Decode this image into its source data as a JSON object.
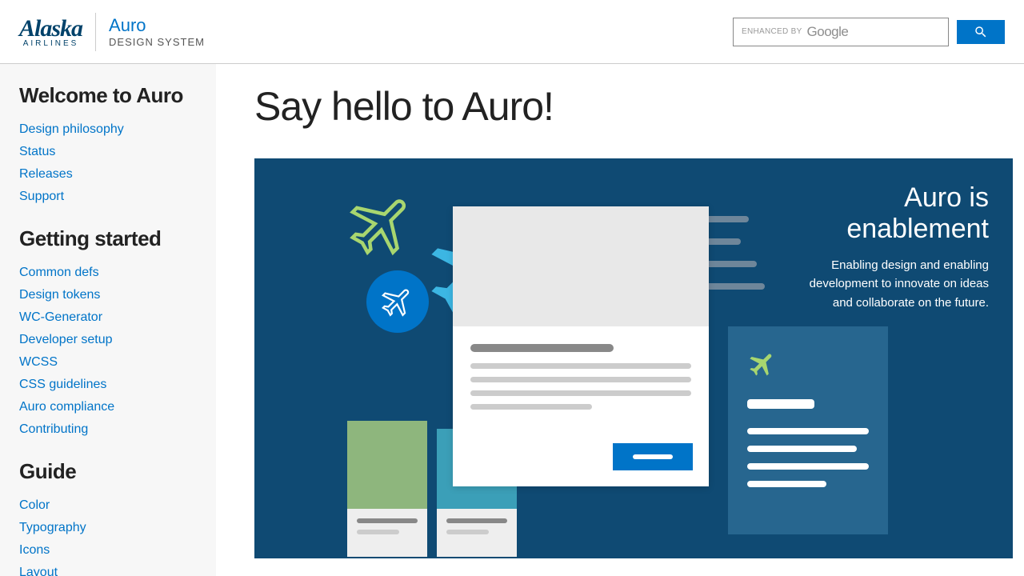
{
  "header": {
    "logo": {
      "brand": "Alaska",
      "brand_sub": "AIRLINES",
      "product": "Auro",
      "product_sub": "DESIGN SYSTEM"
    },
    "search": {
      "enhanced": "ENHANCED BY",
      "google": "Google"
    }
  },
  "sidebar": {
    "groups": [
      {
        "heading": "Welcome to Auro",
        "links": [
          "Design philosophy",
          "Status",
          "Releases",
          "Support"
        ]
      },
      {
        "heading": "Getting started",
        "links": [
          "Common defs",
          "Design tokens",
          "WC-Generator",
          "Developer setup",
          "WCSS",
          "CSS guidelines",
          "Auro compliance",
          "Contributing"
        ]
      },
      {
        "heading": "Guide",
        "links": [
          "Color",
          "Typography",
          "Icons",
          "Layout"
        ]
      }
    ]
  },
  "main": {
    "title": "Say hello to Auro!",
    "hero": {
      "title": "Auro is enablement",
      "body": "Enabling design and enabling development to innovate on ideas and collaborate on the future."
    }
  }
}
